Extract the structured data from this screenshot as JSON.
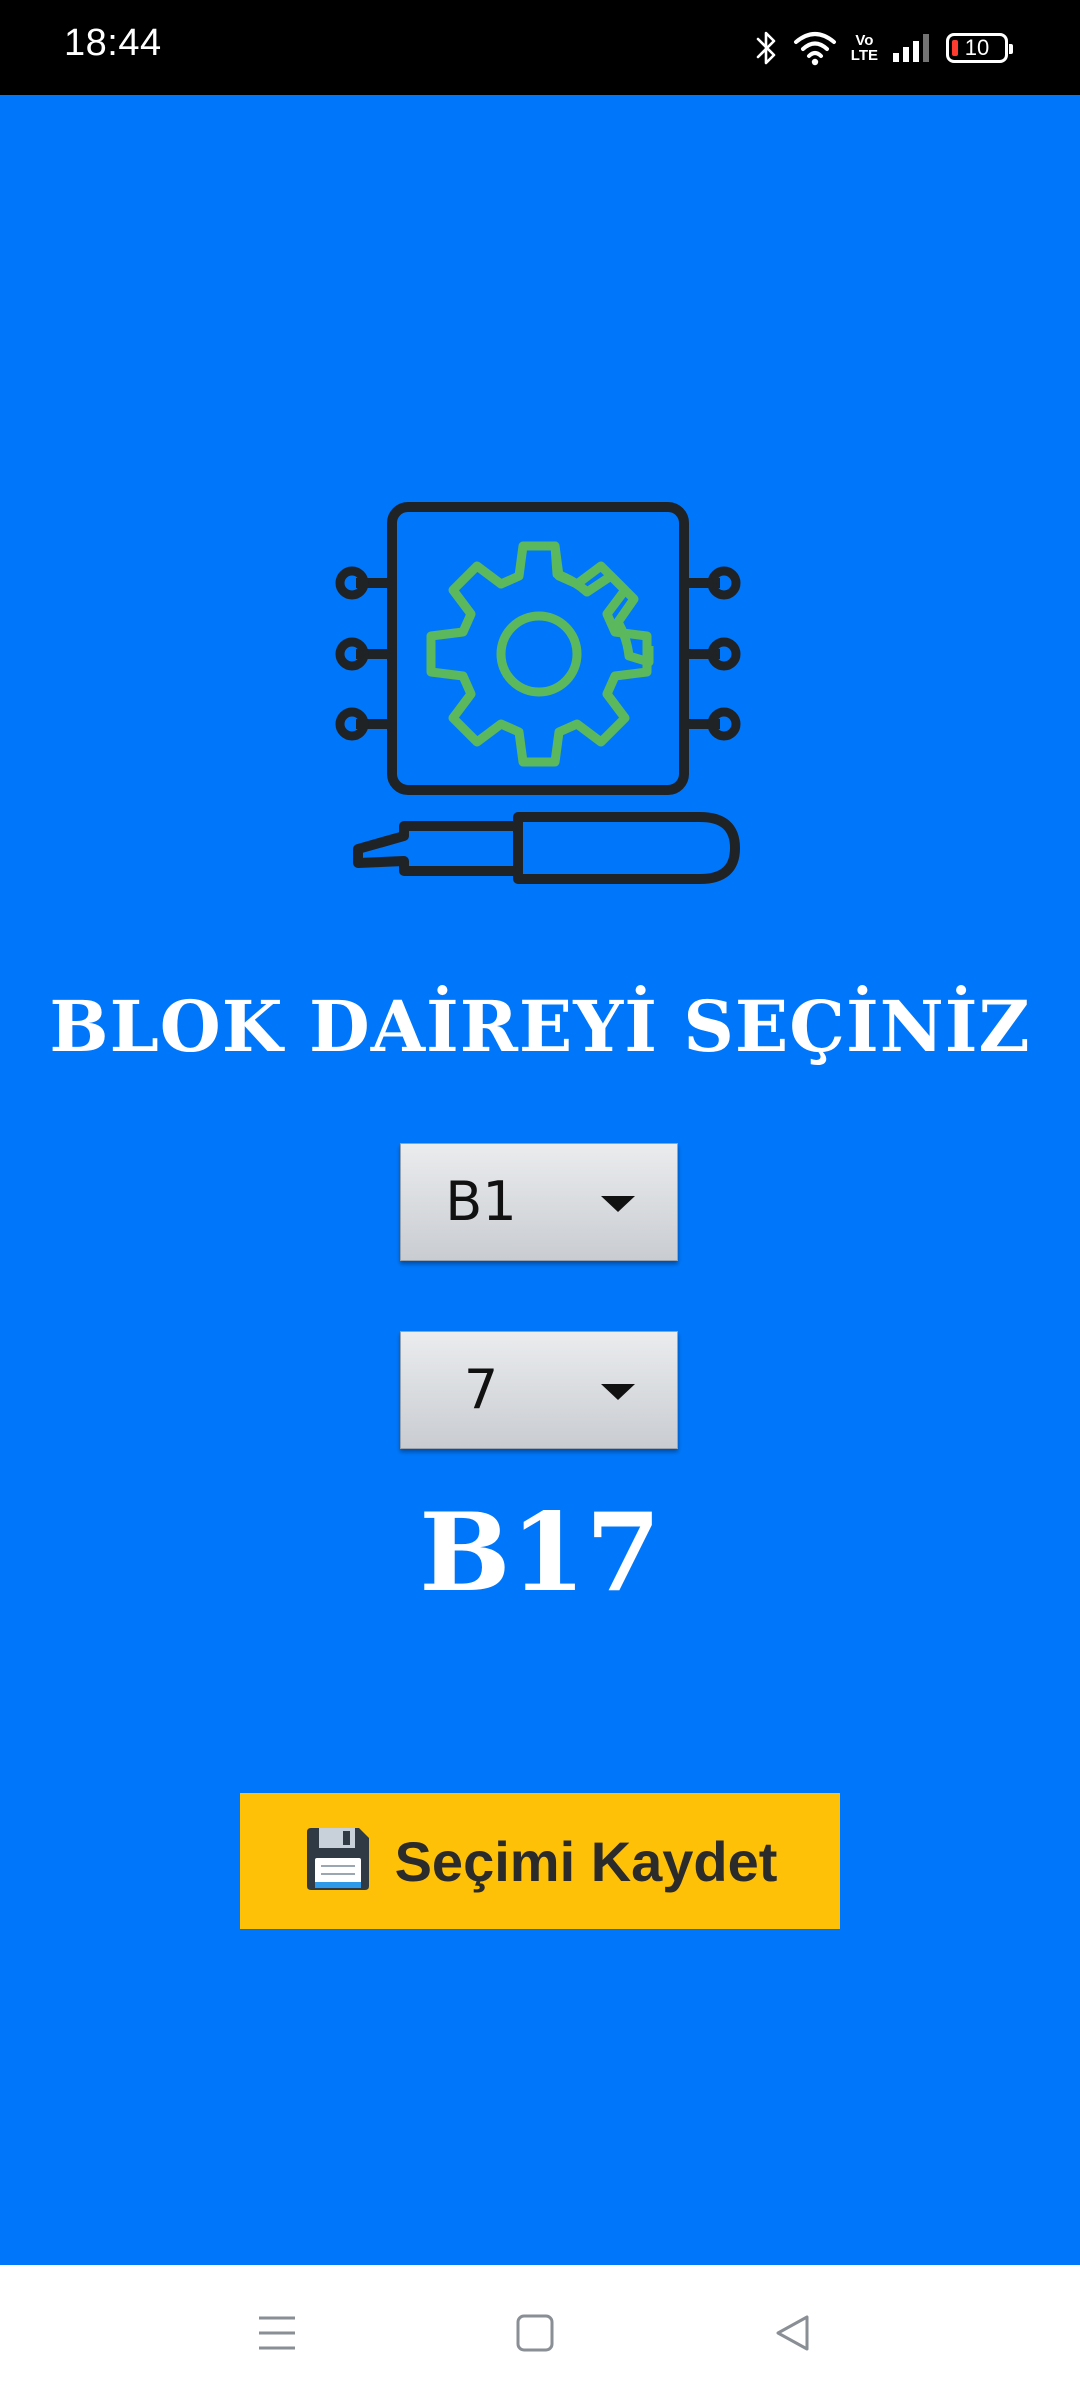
{
  "status_bar": {
    "time": "18:44",
    "battery_level": "10",
    "volte_top": "Vo",
    "volte_bottom": "LTE",
    "icons": [
      "bluetooth-icon",
      "wifi-icon",
      "volte-icon",
      "signal-icon",
      "battery-icon"
    ]
  },
  "main": {
    "illustration_icon": "circuit-gear-screwdriver-icon",
    "heading": "BLOK DAİREYİ SEÇİNİZ",
    "block_select": {
      "selected": "B1"
    },
    "flat_select": {
      "selected": "7"
    },
    "selection_result": "B17",
    "save_button": {
      "label": "Seçimi Kaydet",
      "icon": "floppy-disk-icon"
    }
  },
  "nav_bar": {
    "items": [
      "menu-icon",
      "home-square-icon",
      "back-triangle-icon"
    ]
  },
  "colors": {
    "background": "#0077fa",
    "accent_button": "#ffc107",
    "gear": "#5cb85c",
    "outline": "#1f2326"
  }
}
